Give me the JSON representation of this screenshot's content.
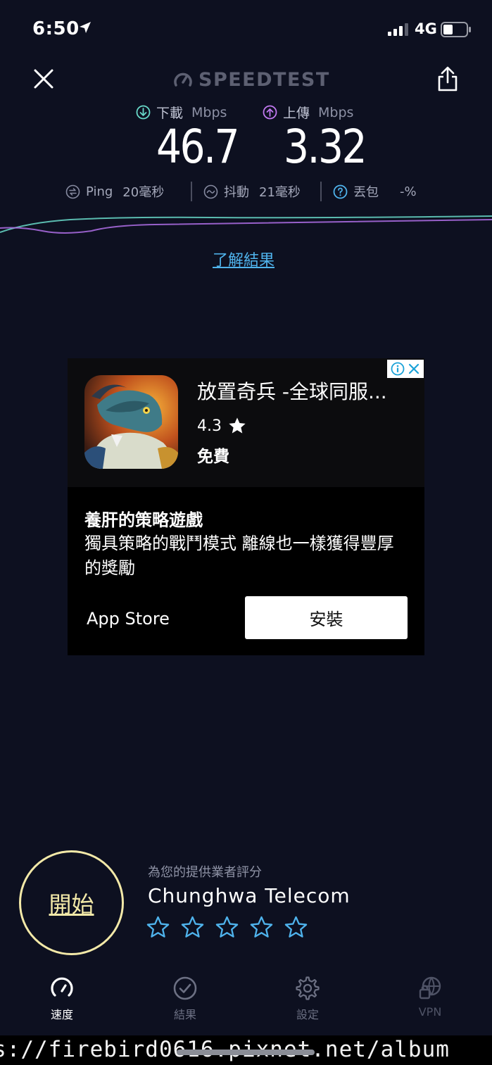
{
  "status_bar": {
    "time": "6:50",
    "network": "4G"
  },
  "header": {
    "brand": "SPEEDTEST"
  },
  "speeds": {
    "download": {
      "label": "下載",
      "unit": "Mbps",
      "value": "46.7"
    },
    "upload": {
      "label": "上傳",
      "unit": "Mbps",
      "value": "3.32"
    }
  },
  "metrics": {
    "ping": {
      "label": "Ping",
      "value": "20毫秒"
    },
    "jitter": {
      "label": "抖動",
      "value": "21毫秒"
    },
    "loss": {
      "label": "丟包",
      "value": "-%"
    }
  },
  "learn_link": "了解結果",
  "ad": {
    "app_title": "放置奇兵 -全球同服...",
    "rating": "4.3",
    "price": "免費",
    "headline": "養肝的策略遊戲",
    "body": "獨具策略的戰鬥模式 離線也一樣獲得豐厚的獎勵",
    "store": "App Store",
    "install_label": "安裝"
  },
  "start_label": "開始",
  "provider": {
    "rate_label": "為您的提供業者評分",
    "name": "Chunghwa Telecom",
    "stars_total": 5,
    "stars_filled": 0
  },
  "tabs": [
    {
      "label": "速度",
      "icon": "speedometer-icon",
      "active": true
    },
    {
      "label": "結果",
      "icon": "check-circle-icon",
      "active": false
    },
    {
      "label": "設定",
      "icon": "gear-icon",
      "active": false
    },
    {
      "label": "VPN",
      "icon": "vpn-lock-globe-icon",
      "active": false
    }
  ],
  "watermark": "s://firebird0616.pixnet.net/album",
  "colors": {
    "background": "#0d1020",
    "download_accent": "#68d9c9",
    "upload_accent": "#c179f0",
    "start_ring": "#f3e9a8",
    "link": "#4fb3ec"
  }
}
